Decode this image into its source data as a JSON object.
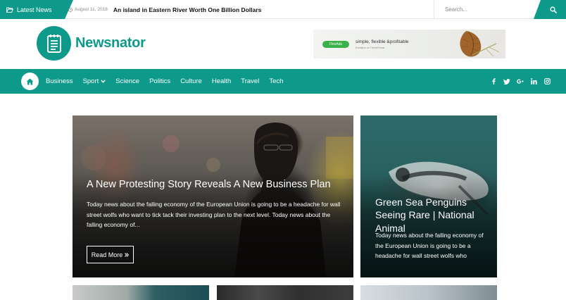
{
  "topbar": {
    "latest_label": "Latest News",
    "ticker_date": "August 11, 2018",
    "ticker_title": "An island in Eastern River Worth One Billion Dollars",
    "search_placeholder": "Search..."
  },
  "header": {
    "site_name": "Newsnator",
    "ad": {
      "badge": "FlexAds",
      "tagline": "simple, flexible &profitable",
      "subline": "Exclusive on ThemeForest"
    }
  },
  "nav": {
    "items": [
      {
        "label": "Business"
      },
      {
        "label": "Sport",
        "has_dropdown": true
      },
      {
        "label": "Science"
      },
      {
        "label": "Politics"
      },
      {
        "label": "Culture"
      },
      {
        "label": "Health"
      },
      {
        "label": "Travel"
      },
      {
        "label": "Tech"
      }
    ],
    "socials": [
      "facebook-icon",
      "twitter-icon",
      "google-plus-icon",
      "linkedin-icon",
      "instagram-icon"
    ]
  },
  "featured": {
    "main": {
      "title": "A New Protesting Story Reveals A New Business Plan",
      "excerpt": "Today news about the falling economy of the European Union is going to be a headache for wall street wolfs who want to tick tack their investing plan to the next level. Today news about the falling economy of...",
      "button": "Read More"
    },
    "side": {
      "title": "Green Sea Penguins Seeing Rare | National Animal",
      "excerpt": "Today news about the falling economy of the European Union is going to be a headache for wall street wolfs who"
    }
  },
  "colors": {
    "accent": "#0e9a8a",
    "text_dark": "#111111",
    "muted": "#888888"
  }
}
